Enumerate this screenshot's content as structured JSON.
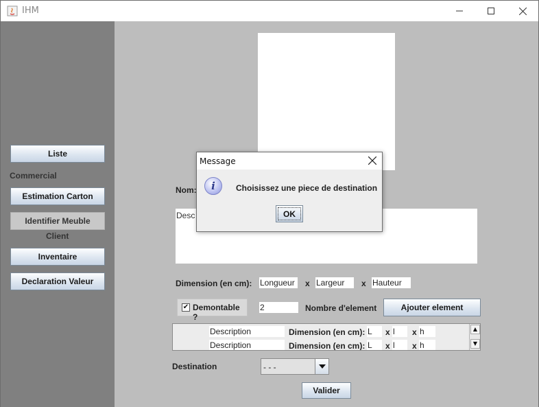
{
  "window": {
    "title": "IHM"
  },
  "sidebar": {
    "liste": "Liste",
    "commercial_label": "Commercial",
    "estimation": "Estimation Carton",
    "identifier": "Identifier Meuble",
    "client_label": "Client",
    "inventaire": "Inventaire",
    "declaration": "Declaration Valeur"
  },
  "form": {
    "nom_label": "Nom:",
    "description_placeholder": "Desc",
    "dimension_label": "Dimension (en cm):",
    "longueur": "Longueur",
    "largeur": "Largeur",
    "hauteur": "Hauteur",
    "x_sep": "x",
    "demontable_label": "Demontable ?",
    "demontable_checked": "✔",
    "nombre_value": "2",
    "nombre_label": "Nombre d'element",
    "ajouter_button": "Ajouter element",
    "elements": [
      {
        "description": "Description",
        "dim_label": "Dimension (en cm):",
        "l": "L",
        "w": "l",
        "h": "h"
      },
      {
        "description": "Description",
        "dim_label": "Dimension (en cm):",
        "l": "L",
        "w": "l",
        "h": "h"
      }
    ],
    "destination_label": "Destination",
    "destination_value": "- - -",
    "valider_button": "Valider"
  },
  "dialog": {
    "title": "Message",
    "message": "Choisissez une piece de destination",
    "ok": "OK",
    "icon_glyph": "i"
  }
}
